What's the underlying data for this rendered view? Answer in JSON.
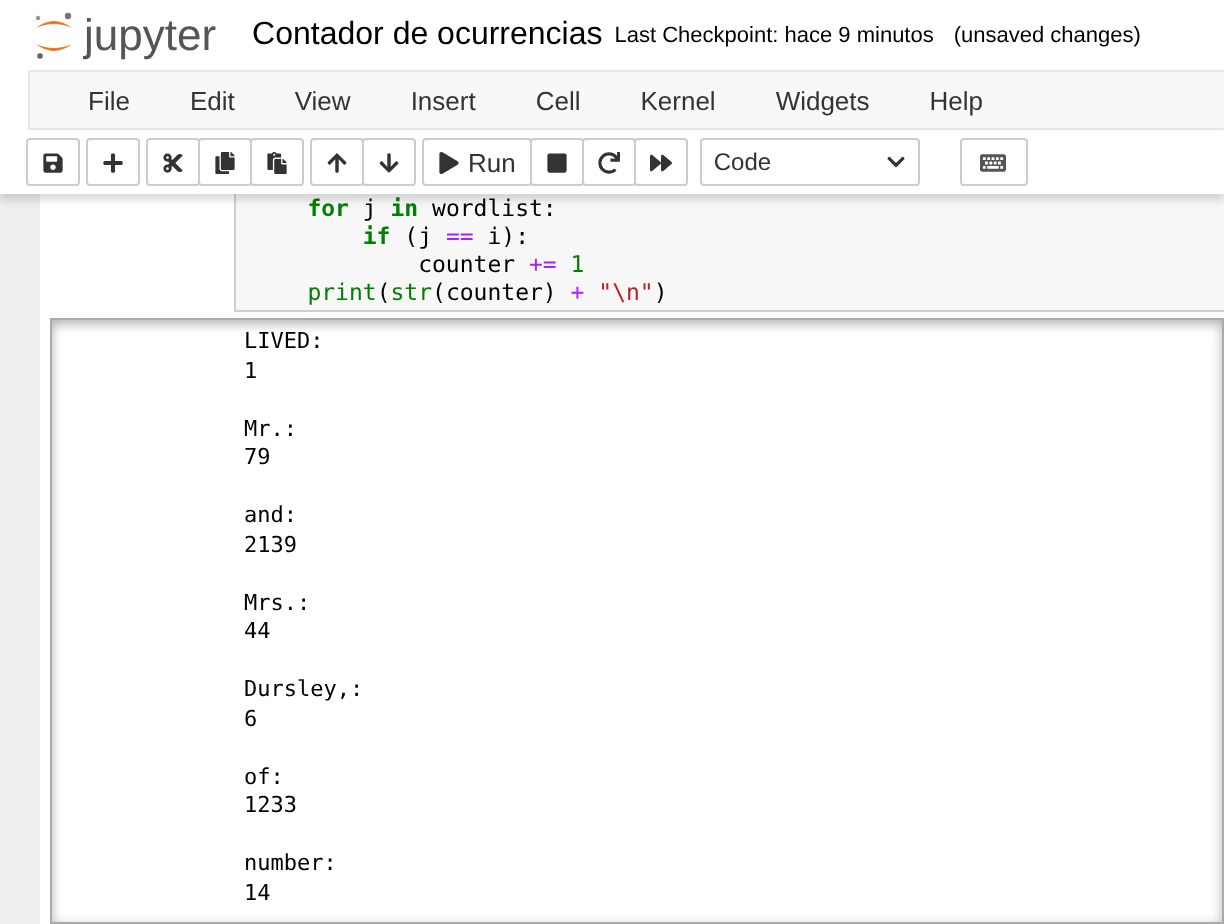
{
  "header": {
    "logo_text": "jupyter",
    "notebook_title": "Contador de ocurrencias",
    "checkpoint": "Last Checkpoint: hace 9 minutos",
    "save_status": "(unsaved changes)"
  },
  "menu": [
    "File",
    "Edit",
    "View",
    "Insert",
    "Cell",
    "Kernel",
    "Widgets",
    "Help"
  ],
  "toolbar": {
    "run_label": "Run",
    "cell_type": "Code"
  },
  "code_lines": [
    [
      {
        "kind": "keyword",
        "text": "    for"
      },
      {
        "kind": "plain",
        "text": " j "
      },
      {
        "kind": "keyword",
        "text": "in"
      },
      {
        "kind": "plain",
        "text": " wordlist:"
      }
    ],
    [
      {
        "kind": "keyword",
        "text": "        if"
      },
      {
        "kind": "plain",
        "text": " (j "
      },
      {
        "kind": "operator",
        "text": "=="
      },
      {
        "kind": "plain",
        "text": " i):"
      }
    ],
    [
      {
        "kind": "plain",
        "text": "            counter "
      },
      {
        "kind": "operator",
        "text": "+="
      },
      {
        "kind": "number",
        "text": " 1"
      }
    ],
    [
      {
        "kind": "builtin",
        "text": "    print"
      },
      {
        "kind": "plain",
        "text": "("
      },
      {
        "kind": "builtin",
        "text": "str"
      },
      {
        "kind": "plain",
        "text": "(counter) "
      },
      {
        "kind": "operator",
        "text": "+"
      },
      {
        "kind": "string",
        "text": " \"\\n\""
      },
      {
        "kind": "plain",
        "text": ")"
      }
    ]
  ],
  "output": [
    {
      "word": "LIVED:",
      "count": "1"
    },
    {
      "word": "Mr.:",
      "count": "79"
    },
    {
      "word": "and:",
      "count": "2139"
    },
    {
      "word": "Mrs.:",
      "count": "44"
    },
    {
      "word": "Dursley,:",
      "count": "6"
    },
    {
      "word": "of:",
      "count": "1233"
    },
    {
      "word": "number:",
      "count": "14"
    }
  ]
}
